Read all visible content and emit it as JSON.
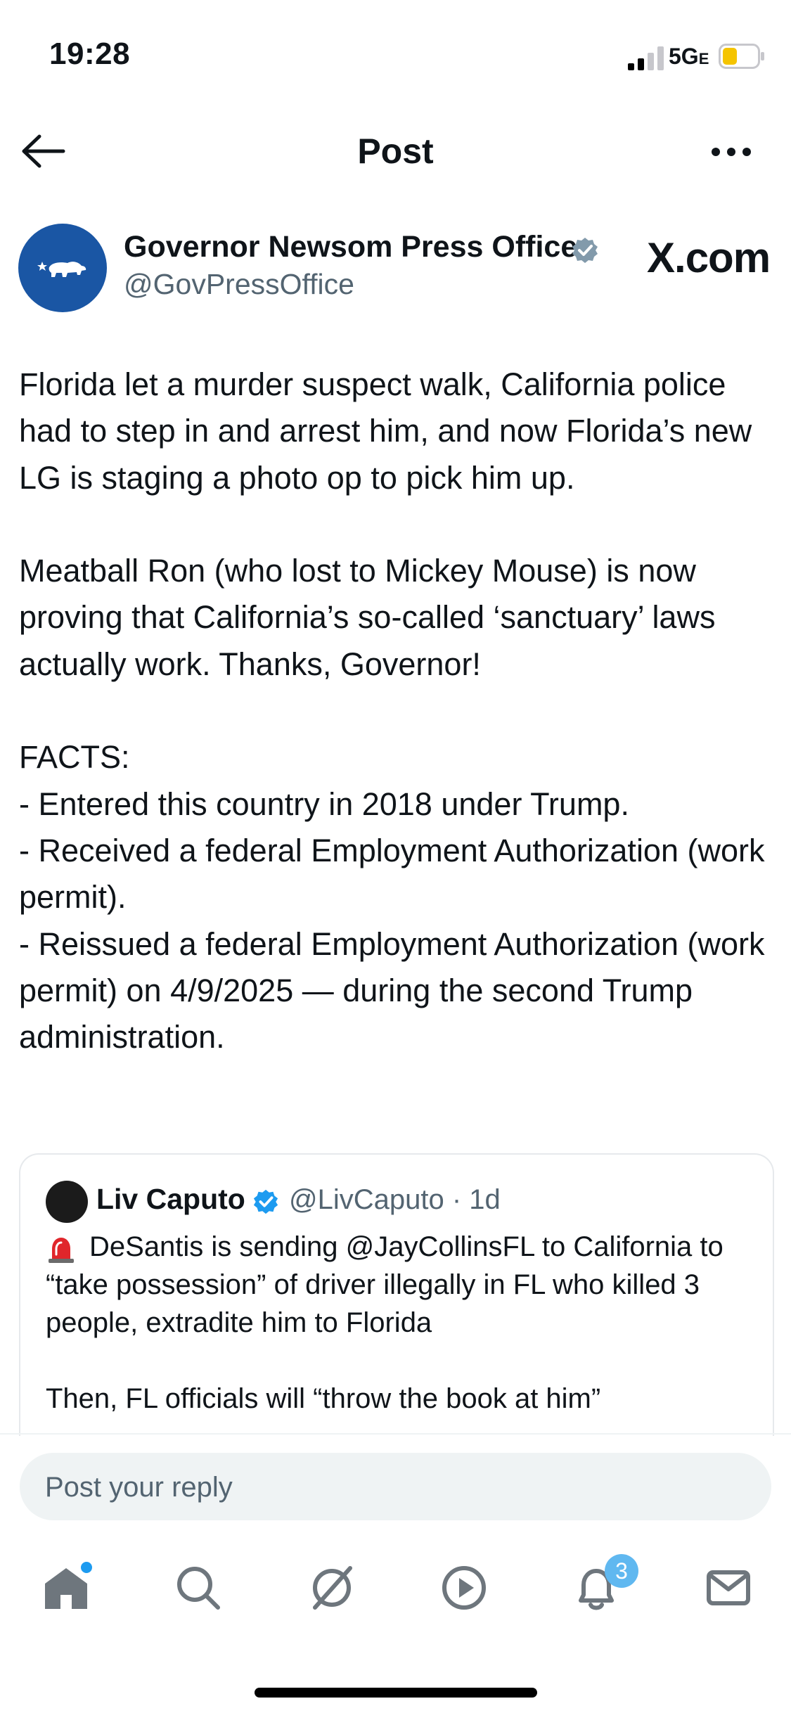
{
  "status_bar": {
    "time": "19:28",
    "network": "5G",
    "network_suffix": "E"
  },
  "header": {
    "title": "Post"
  },
  "author": {
    "name": "Governor Newsom Press Office",
    "handle": "@GovPressOffice",
    "brand_watermark": "X.com"
  },
  "post": {
    "text": "Florida let a murder suspect walk, California police had to step in and arrest him, and now Florida’s new LG is staging a photo op to pick him up.\n\nMeatball Ron (who lost to Mickey Mouse) is now proving that California’s so-called ‘sanctuary’ laws actually work. Thanks, Governor!\n\nFACTS:\n- Entered this country in 2018 under Trump.\n- Received a federal Employment Authorization (work permit).\n- Reissued a federal Employment Authorization (work permit) on 4/9/2025 — during the second Trump administration."
  },
  "quoted_post": {
    "name": "Liv Caputo",
    "handle_time": "@LivCaputo · 1d",
    "text": "DeSantis is sending @JayCollinsFL to California to “take possession” of driver illegally in FL who killed 3 people, extradite him to Florida\n\nThen, FL officials will “throw the book at him”"
  },
  "reply": {
    "placeholder": "Post your reply"
  },
  "tab_bar": {
    "items": [
      "home-icon",
      "search-icon",
      "grok-icon",
      "video-icon",
      "notifications-icon",
      "messages-icon"
    ],
    "notifications_badge": "3"
  },
  "colors": {
    "accent": "#1d9bf0",
    "secondary_text": "#536471",
    "verified_gray": "#829aab",
    "verified_blue": "#1d9bf0",
    "battery_yellow": "#f5c400",
    "avatar_blue": "#1a56a4"
  }
}
